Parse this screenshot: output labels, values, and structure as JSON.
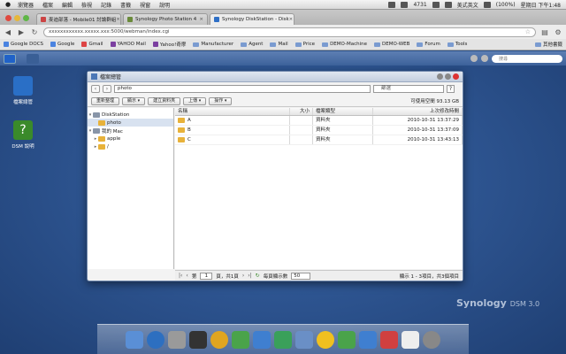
{
  "menubar": {
    "apple": "",
    "items": [
      "瀏覽器",
      "檔案",
      "編輯",
      "檢視",
      "記錄",
      "書籤",
      "視窗",
      "說明"
    ],
    "status": [
      "4731",
      "美式英文",
      "(100%)",
      "星期日 下午1:48"
    ]
  },
  "tabs": [
    {
      "label": "麥迪部落 - Mobile01 討論群組",
      "color": "#cc4444"
    },
    {
      "label": "Synology Photo Station 4",
      "color": "#6a8a3a"
    },
    {
      "label": "Synology DiskStation - Disk",
      "color": "#2e6fc6"
    }
  ],
  "omnibox": {
    "url": "xxxxxxxxxxxx.xxxxx.xxx:5000/webman/index.cgi"
  },
  "bookmarks": [
    "Google DOCS",
    "Google",
    "Gmail",
    "YAHOO Mail",
    "Yahoo!奇摩",
    "Manufacturer",
    "Agent",
    "Mail",
    "Price",
    "DEMO-Machine",
    "DEMO-WEB",
    "Forum",
    "Tools"
  ],
  "bookmarks_other": "其他書籤",
  "dsm": {
    "search_placeholder": "搜尋"
  },
  "desktop_icons": [
    {
      "label": "檔案總管",
      "color": "#2a6fc6"
    },
    {
      "label": "DSM 說明",
      "color": "#3a8a2a"
    }
  ],
  "window": {
    "title": "檔案總管",
    "path": "photo",
    "search_placeholder": "篩選",
    "help": "?",
    "actions": {
      "reload": "重新整理",
      "view": "顯示",
      "new_folder": "建立資料夾",
      "upload": "上傳",
      "action": "操作"
    },
    "free_space": "可使用空間 93.13 GB",
    "tree": [
      {
        "label": "DiskStation",
        "level": 0,
        "type": "hd",
        "toggle": "▾"
      },
      {
        "label": "photo",
        "level": 1,
        "type": "folder",
        "selected": true,
        "toggle": ""
      },
      {
        "label": "我的 Mac",
        "level": 0,
        "type": "hd",
        "toggle": "▾"
      },
      {
        "label": "apple",
        "level": 1,
        "type": "folder",
        "toggle": "▸"
      },
      {
        "label": "/",
        "level": 1,
        "type": "folder",
        "toggle": "▸"
      }
    ],
    "columns": {
      "name": "名稱",
      "size": "大小",
      "type": "檔案類型",
      "modified": "上次修改時間"
    },
    "rows": [
      {
        "name": "A",
        "size": "",
        "type": "資料夾",
        "modified": "2010-10-31 13:37:29"
      },
      {
        "name": "B",
        "size": "",
        "type": "資料夾",
        "modified": "2010-10-31 13:37:09"
      },
      {
        "name": "C",
        "size": "",
        "type": "資料夾",
        "modified": "2010-10-31 13:43:13"
      }
    ],
    "pager": {
      "page_prefix": "第",
      "page": "1",
      "page_suffix": "頁，共1頁",
      "per_page_label": "每頁顯示數",
      "per_page": "50",
      "display": "顯示 1 - 3項目，共3個項目"
    }
  },
  "brand": {
    "name": "Synology",
    "version": "DSM 3.0"
  }
}
